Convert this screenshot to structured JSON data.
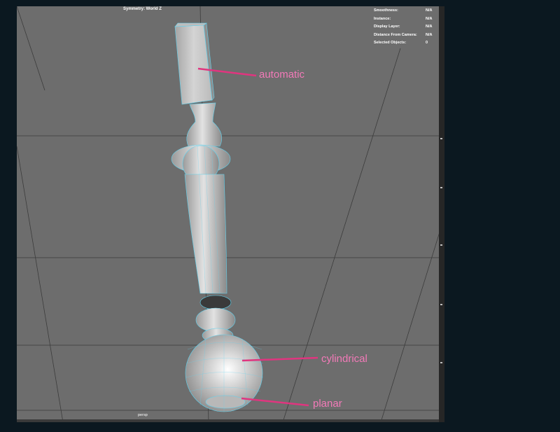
{
  "viewport": {
    "symmetry_label": "Symmetry: World Z",
    "camera_label": "persp",
    "hud": [
      {
        "label": "Smoothness:",
        "value": "N/A"
      },
      {
        "label": "Instance:",
        "value": "N/A"
      },
      {
        "label": "Display Layer:",
        "value": "N/A"
      },
      {
        "label": "Distance From Camera:",
        "value": "N/A"
      },
      {
        "label": "Selected Objects:",
        "value": "0"
      }
    ]
  },
  "annotations": {
    "top": "automatic",
    "middle": "cylindrical",
    "bottom": "planar",
    "color": "#e0357f"
  },
  "colors": {
    "viewport_bg": "#6d6d6d",
    "wireframe": "#5fd3f0",
    "model_fill": "#c9c9c9",
    "background": "#0b1820"
  }
}
